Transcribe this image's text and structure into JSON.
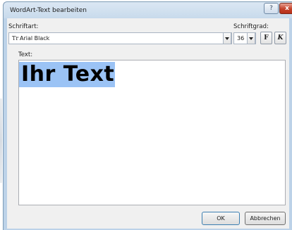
{
  "window": {
    "title": "WordArt-Text bearbeiten",
    "help_label": "?",
    "close_label": "x"
  },
  "font": {
    "label": "Schriftart:",
    "value": "Arial Black",
    "type_glyph": "Tr"
  },
  "size": {
    "label": "Schriftgrad:",
    "value": "36"
  },
  "format": {
    "bold_label": "F",
    "italic_label": "K"
  },
  "text": {
    "label": "Text:",
    "value": "Ihr Text"
  },
  "buttons": {
    "ok": "OK",
    "cancel": "Abbrechen"
  },
  "colors": {
    "selection": "#9bc3f5",
    "title_bar": "#c9dbec",
    "close_button": "#c4412a"
  }
}
